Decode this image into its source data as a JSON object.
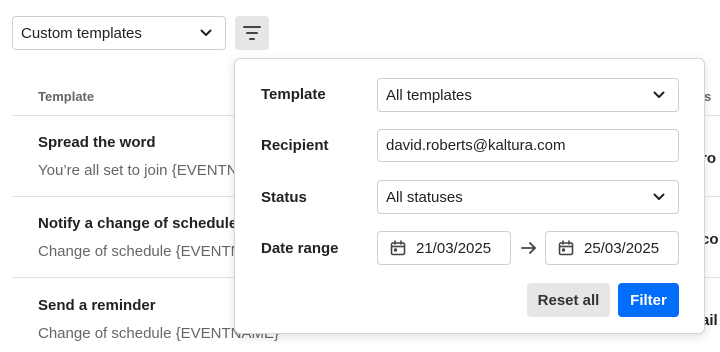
{
  "toolbar": {
    "template_select_value": "Custom templates"
  },
  "table": {
    "headers": [
      "Template",
      "Status"
    ],
    "header_status_visible": "us",
    "rows": [
      {
        "title": "Spread the word",
        "subtitle": "You’re all set to join {EVENTNA",
        "right": "ro"
      },
      {
        "title": "Notify a change of schedule",
        "subtitle": "Change of schedule {EVENTN",
        "right": "co"
      },
      {
        "title": "Send a reminder",
        "subtitle": "Change of schedule {EVENTNAME}",
        "right": "ail"
      }
    ]
  },
  "filter_panel": {
    "template_label": "Template",
    "template_value": "All templates",
    "recipient_label": "Recipient",
    "recipient_value": "david.roberts@kaltura.com",
    "status_label": "Status",
    "status_value": "All statuses",
    "date_label": "Date range",
    "date_from": "21/03/2025",
    "date_to": "25/03/2025",
    "reset_label": "Reset all",
    "filter_label": "Filter"
  },
  "colors": {
    "primary": "#006efa",
    "secondary_button": "#e6e6e6"
  }
}
